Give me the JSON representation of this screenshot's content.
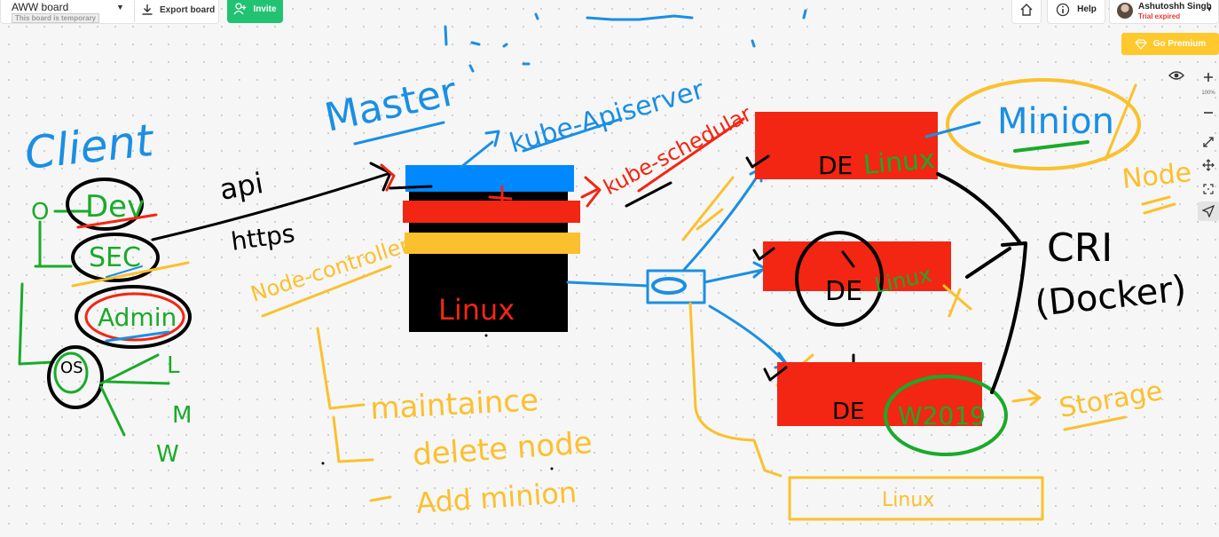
{
  "topbar": {
    "board_name": "AWW board",
    "board_notice": "This board is temporary",
    "export_label": "Export board",
    "invite_label": "Invite",
    "help_label": "Help",
    "user_name": "Ashutoshh Singh",
    "user_status": "Trial expired",
    "premium_label": "Go Premium"
  },
  "toolbar": {
    "zoom_level": "100%",
    "icons": [
      "eye-icon",
      "zoom-in-icon",
      "zoom-out-icon",
      "expand-icon",
      "move-icon",
      "fit-icon",
      "pointer-icon"
    ]
  },
  "board": {
    "texts": {
      "client": "Client",
      "dev": "Dev",
      "sec": "SEC",
      "admin": "Admin",
      "os": "OS",
      "bullet_o": "O",
      "os_l": "L",
      "os_m": "M",
      "os_w": "W",
      "master": "Master",
      "api": "api",
      "https": "https",
      "kube_apiserver": "kube-Apiserver",
      "kube_scheduler": "kube-schedular",
      "node_controller": "Node-controller",
      "master_os": "Linux",
      "maintainace": "maintaince",
      "delete_node": "delete node",
      "add_minion": "Add minion",
      "minion": "Minion",
      "node": "Node",
      "de_top": "DE",
      "de_top_os": "Linux",
      "de_mid": "DE",
      "de_mid_os": "Linux",
      "de_bottom": "DE",
      "de_bottom_os": "W2019",
      "cri": "CRI",
      "docker": "(Docker)",
      "storage": "Storage",
      "storage_os": "Linux"
    },
    "colors": {
      "blue": "#1a8fe3",
      "green": "#1aaa2a",
      "red": "#f22613",
      "yellow": "#fbc02d",
      "black": "#000000"
    }
  }
}
